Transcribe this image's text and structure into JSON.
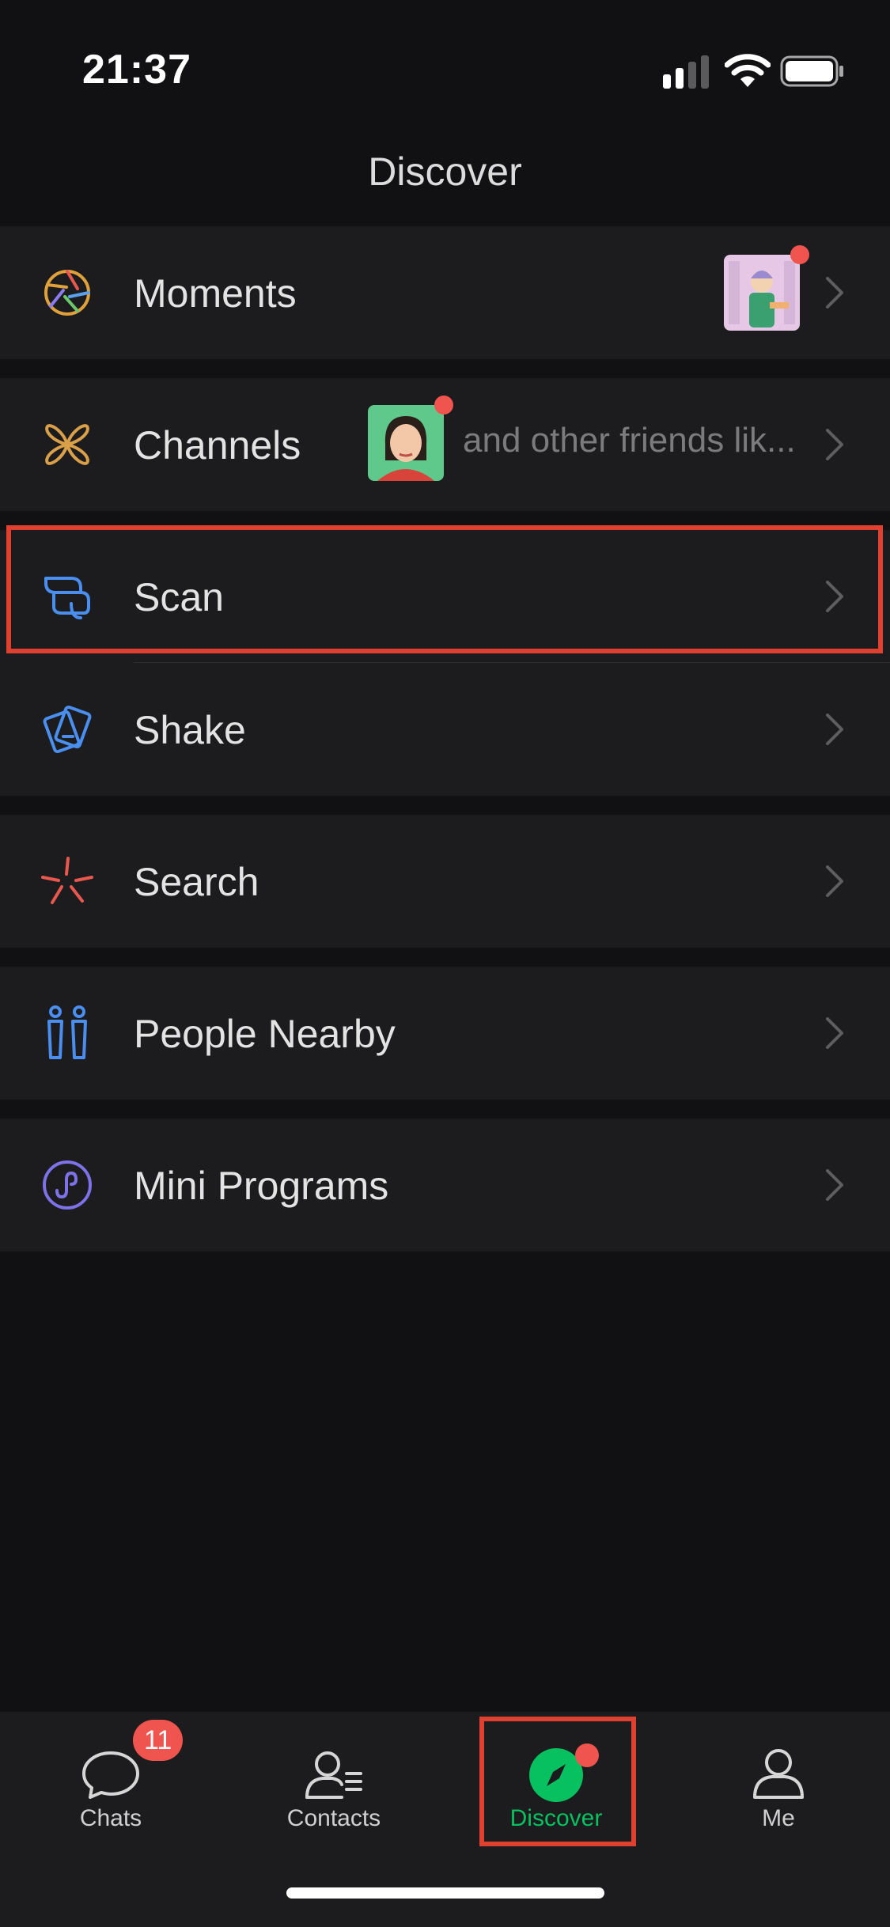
{
  "status": {
    "time": "21:37"
  },
  "nav": {
    "title": "Discover"
  },
  "menu": {
    "moments": {
      "label": "Moments"
    },
    "channels": {
      "label": "Channels",
      "description": "and other friends lik..."
    },
    "scan": {
      "label": "Scan"
    },
    "shake": {
      "label": "Shake"
    },
    "search": {
      "label": "Search"
    },
    "people_nearby": {
      "label": "People Nearby"
    },
    "mini_programs": {
      "label": "Mini Programs"
    }
  },
  "tabbar": {
    "chats": {
      "label": "Chats",
      "badge": "11"
    },
    "contacts": {
      "label": "Contacts"
    },
    "discover": {
      "label": "Discover",
      "active": true
    },
    "me": {
      "label": "Me"
    }
  },
  "colors": {
    "background": "#111113",
    "cell": "#1c1c1e",
    "accent_green": "#07c160",
    "badge_red": "#f0544f",
    "highlight": "#e0402f"
  },
  "icons": {
    "moments": "aperture-icon",
    "channels": "butterfly-icon",
    "scan": "scan-icon",
    "shake": "shake-icon",
    "search": "sparkle-search-icon",
    "people_nearby": "people-icon",
    "mini_programs": "link-circle-icon"
  }
}
